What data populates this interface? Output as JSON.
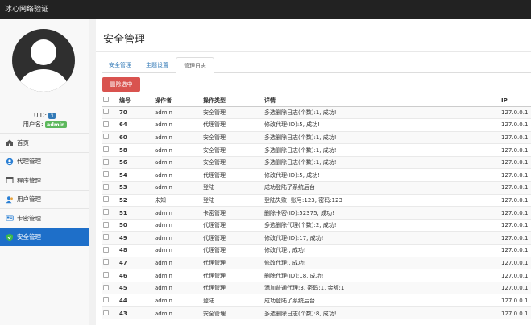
{
  "app_title": "冰心网络验证",
  "user": {
    "uid_label": "UID:",
    "uid": "1",
    "username_label": "用户名:",
    "username": "admin"
  },
  "menu": [
    {
      "label": "首页",
      "icon": "home-icon"
    },
    {
      "label": "代理管理",
      "icon": "agent-icon"
    },
    {
      "label": "程序管理",
      "icon": "program-icon"
    },
    {
      "label": "用户管理",
      "icon": "user-icon"
    },
    {
      "label": "卡密管理",
      "icon": "card-icon"
    },
    {
      "label": "安全管理",
      "icon": "shield-icon",
      "active": true
    }
  ],
  "page_title": "安全管理",
  "tabs": [
    {
      "label": "安全管理"
    },
    {
      "label": "主题设置"
    },
    {
      "label": "管理日志",
      "active": true
    }
  ],
  "delete_button": "删除选中",
  "table": {
    "headers": [
      "编号",
      "操作者",
      "操作类型",
      "详情",
      "IP"
    ],
    "rows": [
      [
        "70",
        "admin",
        "安全管理",
        "多选删除日志(个数):1, 成功!",
        "127.0.0.1"
      ],
      [
        "64",
        "admin",
        "代理管理",
        "修改代理(ID):5, 成功!",
        "127.0.0.1"
      ],
      [
        "60",
        "admin",
        "安全管理",
        "多选删除日志(个数):1, 成功!",
        "127.0.0.1"
      ],
      [
        "58",
        "admin",
        "安全管理",
        "多选删除日志(个数):1, 成功!",
        "127.0.0.1"
      ],
      [
        "56",
        "admin",
        "安全管理",
        "多选删除日志(个数):1, 成功!",
        "127.0.0.1"
      ],
      [
        "54",
        "admin",
        "代理管理",
        "修改代理(ID):5, 成功!",
        "127.0.0.1"
      ],
      [
        "53",
        "admin",
        "登陆",
        "成功登陆了系统后台",
        "127.0.0.1"
      ],
      [
        "52",
        "未知",
        "登陆",
        "登陆失败! 账号:123, 密码:123",
        "127.0.0.1"
      ],
      [
        "51",
        "admin",
        "卡密管理",
        "删除卡密(ID):52375, 成功!",
        "127.0.0.1"
      ],
      [
        "50",
        "admin",
        "代理管理",
        "多选删除代理(个数):2, 成功!",
        "127.0.0.1"
      ],
      [
        "49",
        "admin",
        "代理管理",
        "修改代理(ID):17, 成功!",
        "127.0.0.1"
      ],
      [
        "48",
        "admin",
        "代理管理",
        "修改代理:, 成功!",
        "127.0.0.1"
      ],
      [
        "47",
        "admin",
        "代理管理",
        "修改代理:, 成功!",
        "127.0.0.1"
      ],
      [
        "46",
        "admin",
        "代理管理",
        "删除代理(ID):18, 成功!",
        "127.0.0.1"
      ],
      [
        "45",
        "admin",
        "代理管理",
        "添加普通代理:3, 密码:1, 余额:1",
        "127.0.0.1"
      ],
      [
        "44",
        "admin",
        "登陆",
        "成功登陆了系统后台",
        "127.0.0.1"
      ],
      [
        "43",
        "admin",
        "安全管理",
        "多选删除日志(个数):8, 成功!",
        "127.0.0.1"
      ]
    ]
  },
  "colors": {
    "topbar": "#222222",
    "active_menu": "#1e6fc9",
    "danger": "#d9534f",
    "link": "#337ab7"
  }
}
